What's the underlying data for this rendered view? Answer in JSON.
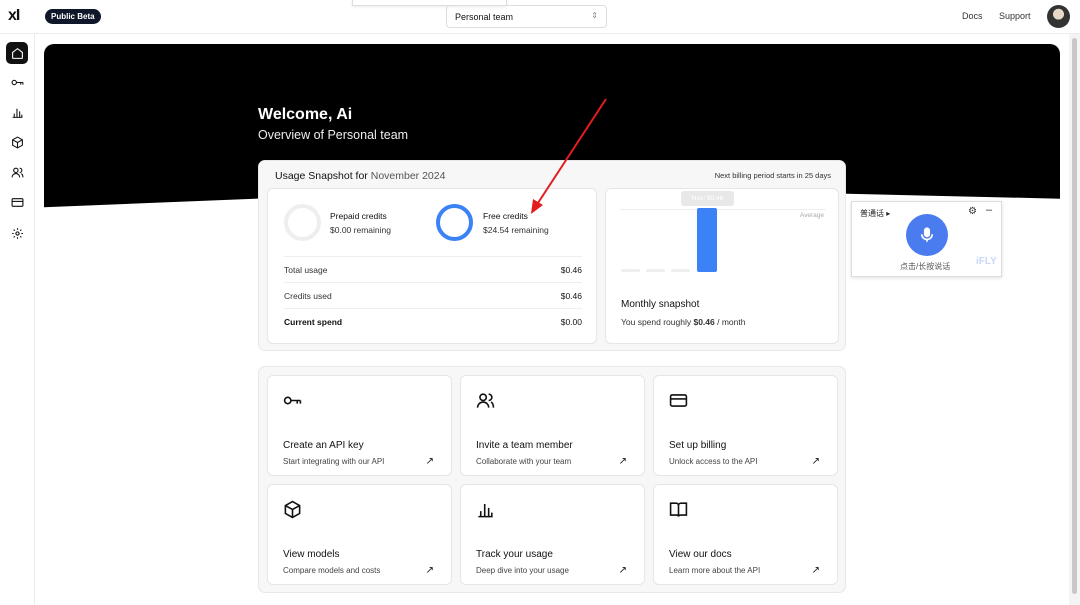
{
  "topbar": {
    "logo": "xI",
    "beta": "Public Beta",
    "team_select": "Personal team",
    "docs": "Docs",
    "support": "Support"
  },
  "sidebar": {
    "items": [
      {
        "icon": "home-icon",
        "active": true
      },
      {
        "icon": "key-icon"
      },
      {
        "icon": "bar-chart-icon"
      },
      {
        "icon": "cube-icon"
      },
      {
        "icon": "users-icon"
      },
      {
        "icon": "credit-card-icon"
      },
      {
        "icon": "gear-icon"
      }
    ]
  },
  "hero": {
    "welcome": "Welcome, Ai",
    "overview": "Overview of Personal team"
  },
  "snapshot": {
    "title": "Usage Snapshot for ",
    "month": "November 2024",
    "next_billing": "Next billing period starts in 25 days",
    "prepaid_label": "Prepaid credits",
    "prepaid_remaining": "$0.00 remaining",
    "free_label": "Free credits",
    "free_remaining": "$24.54 remaining",
    "rows": [
      {
        "label": "Total usage",
        "value": "$0.46"
      },
      {
        "label": "Credits used",
        "value": "$0.46"
      },
      {
        "label": "Current spend",
        "value": "$0.00"
      }
    ],
    "chart_tooltip": "Nov: $0.46",
    "chart_avg": "Average",
    "monthly_title": "Monthly snapshot",
    "monthly_prefix": "You spend roughly ",
    "monthly_amount": "$0.46",
    "monthly_suffix": " / month"
  },
  "actions": [
    {
      "icon": "key-icon",
      "title": "Create an API key",
      "sub": "Start integrating with our API"
    },
    {
      "icon": "users-icon",
      "title": "Invite a team member",
      "sub": "Collaborate with your team"
    },
    {
      "icon": "credit-card-icon",
      "title": "Set up billing",
      "sub": "Unlock access to the API"
    },
    {
      "icon": "cube-icon",
      "title": "View models",
      "sub": "Compare models and costs"
    },
    {
      "icon": "bar-chart-icon",
      "title": "Track your usage",
      "sub": "Deep dive into your usage"
    },
    {
      "icon": "book-icon",
      "title": "View our docs",
      "sub": "Learn more about the API"
    }
  ],
  "ifly": {
    "mode": "普通话 ▸",
    "hint": "点击/长按说话",
    "brand": "iFLY"
  },
  "colors": {
    "accent": "#3b82f6",
    "arrow": "#e11d1d",
    "beta_bg": "#0f172a"
  }
}
